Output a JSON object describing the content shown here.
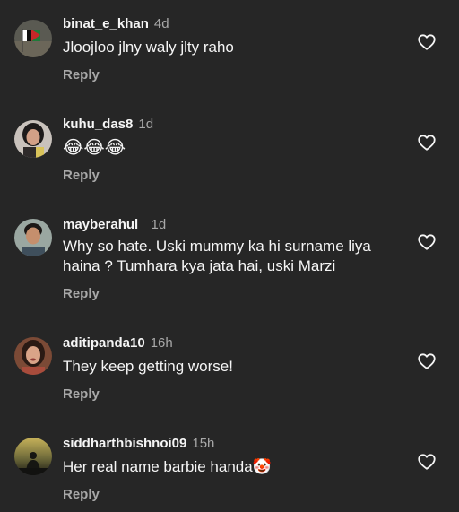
{
  "comments": [
    {
      "username": "binat_e_khan",
      "time": "4d",
      "text": "Jloojloo jlny waly jlty raho",
      "reply_label": "Reply",
      "avatar_icon": "avatar-flag-icon",
      "like_icon": "heart-outline-icon"
    },
    {
      "username": "kuhu_das8",
      "time": "1d",
      "text": "😂😂😂",
      "reply_label": "Reply",
      "avatar_icon": "avatar-person-icon",
      "like_icon": "heart-outline-icon"
    },
    {
      "username": "mayberahul_",
      "time": "1d",
      "text": "Why so hate. Uski mummy ka hi surname liya haina ? Tumhara kya jata hai, uski Marzi",
      "reply_label": "Reply",
      "avatar_icon": "avatar-person-icon",
      "like_icon": "heart-outline-icon"
    },
    {
      "username": "aditipanda10",
      "time": "16h",
      "text": "They keep getting worse!",
      "reply_label": "Reply",
      "avatar_icon": "avatar-person-icon",
      "like_icon": "heart-outline-icon"
    },
    {
      "username": "siddharthbishnoi09",
      "time": "15h",
      "text": "Her real name barbie handa🤡",
      "reply_label": "Reply",
      "avatar_icon": "avatar-silhouette-icon",
      "like_icon": "heart-outline-icon"
    }
  ],
  "colors": {
    "background": "#262626",
    "text": "#f5f5f5",
    "secondary": "#a8a8a8"
  }
}
